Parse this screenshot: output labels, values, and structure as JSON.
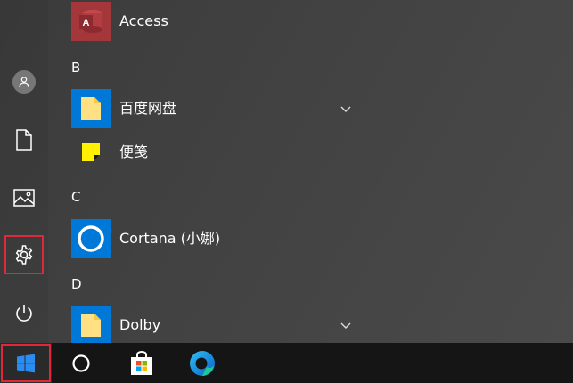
{
  "start_menu": {
    "sections": [
      {
        "letter": "",
        "apps": [
          {
            "name": "Access",
            "icon": "access-icon",
            "color": "#a4373a",
            "expandable": false
          }
        ]
      },
      {
        "letter": "B",
        "apps": [
          {
            "name": "百度网盘",
            "icon": "folder-icon",
            "color": "#0078d7",
            "expandable": true
          },
          {
            "name": "便笺",
            "icon": "sticky-notes-icon",
            "color": "#fff100",
            "expandable": false
          }
        ]
      },
      {
        "letter": "C",
        "apps": [
          {
            "name": "Cortana (小娜)",
            "icon": "cortana-icon",
            "color": "#0078d7",
            "expandable": false
          }
        ]
      },
      {
        "letter": "D",
        "apps": [
          {
            "name": "Dolby",
            "icon": "folder-icon",
            "color": "#0078d7",
            "expandable": true
          }
        ]
      }
    ]
  },
  "left_rail": {
    "items": [
      "user-account",
      "documents",
      "pictures",
      "settings",
      "power"
    ],
    "selected": "settings"
  },
  "taskbar": {
    "items": [
      "start",
      "cortana-search",
      "microsoft-store",
      "edge"
    ],
    "accent": "#0078d7",
    "highlight": "#e0283a"
  }
}
